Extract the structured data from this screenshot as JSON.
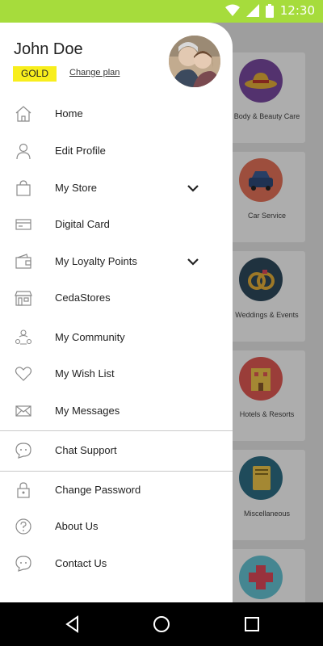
{
  "status_bar": {
    "time": "12:30",
    "icons": [
      "wifi-icon",
      "signal-icon",
      "battery-icon"
    ]
  },
  "profile": {
    "name": "John Doe",
    "plan": "GOLD",
    "change_plan_label": "Change plan"
  },
  "menu": {
    "items": [
      {
        "label": "Home",
        "icon": "home-icon"
      },
      {
        "label": "Edit Profile",
        "icon": "person-icon"
      },
      {
        "label": "My Store",
        "icon": "shopping-bag-icon",
        "expandable": true
      },
      {
        "label": "Digital Card",
        "icon": "card-icon"
      },
      {
        "label": "My Loyalty Points",
        "icon": "wallet-icon",
        "expandable": true
      },
      {
        "label": "CedaStores",
        "icon": "storefront-icon"
      },
      {
        "label": "My Community",
        "icon": "community-icon"
      },
      {
        "label": "My Wish List",
        "icon": "heart-icon"
      },
      {
        "label": "My Messages",
        "icon": "envelope-icon"
      },
      {
        "label": "Chat Support",
        "icon": "chat-bubble-icon"
      },
      {
        "label": "Change Password",
        "icon": "lock-icon"
      },
      {
        "label": "About Us",
        "icon": "question-icon"
      },
      {
        "label": "Contact Us",
        "icon": "chat-bubble-icon"
      }
    ]
  },
  "background": {
    "categories": [
      {
        "label": "Body & Beauty Care",
        "icon": "hat-icon",
        "color": "#7b4aa3"
      },
      {
        "label": "Car Service",
        "icon": "car-icon",
        "color": "#e8735a"
      },
      {
        "label": "Weddings & Events",
        "icon": "rings-icon",
        "color": "#2f4a5e"
      },
      {
        "label": "Hotels & Resorts",
        "icon": "hotel-icon",
        "color": "#e45a55"
      },
      {
        "label": "Miscellaneous",
        "icon": "notebook-icon",
        "color": "#2f6f86"
      },
      {
        "label": "",
        "icon": "medical-cross-icon",
        "color": "#66c6d6"
      }
    ]
  },
  "nav_bar": {
    "buttons": [
      "back-icon",
      "home-circle-icon",
      "recents-icon"
    ]
  },
  "colors": {
    "status_bar": "#a6dc3c",
    "badge": "#f8ee1d",
    "nav_bar": "#000000"
  }
}
